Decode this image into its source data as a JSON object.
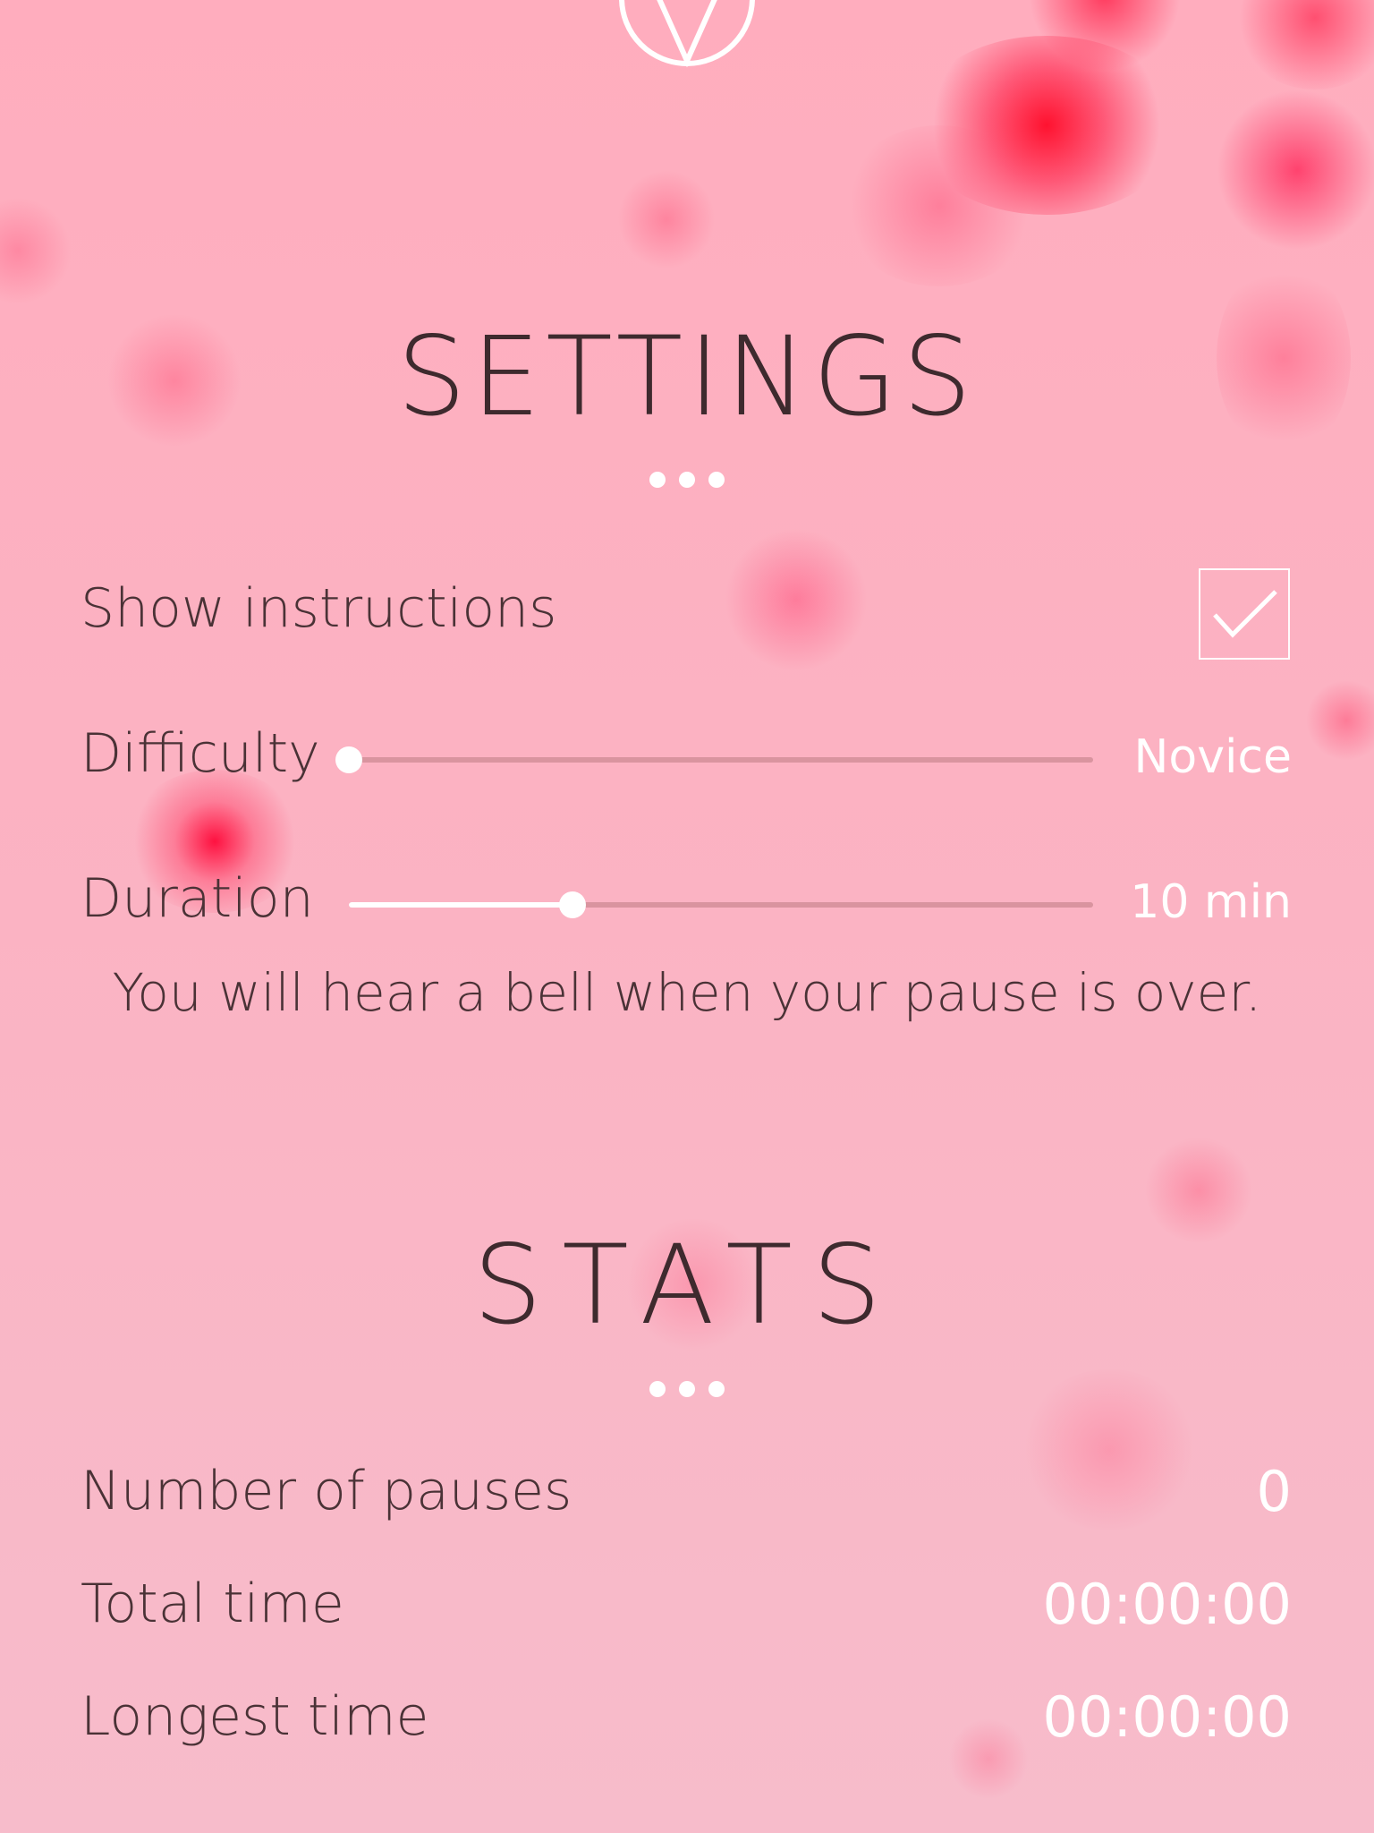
{
  "theme": {
    "background": "#fbb3c3",
    "text": "#4a3236",
    "title": "#3e2a2e",
    "value": "#ffffff",
    "slider_track": "#d9949f",
    "slider_fill": "#ffffff",
    "accent_blob": "#ff1744"
  },
  "header": {
    "logo_icon": "leaf-circle-icon"
  },
  "settings": {
    "title": "SETTINGS",
    "show_instructions": {
      "label": "Show instructions",
      "checked": true,
      "icon": "checkmark-icon"
    },
    "difficulty": {
      "label": "Difficulty",
      "value": "Novice",
      "level": 0.0
    },
    "duration": {
      "label": "Duration",
      "value": "10 min",
      "level": 0.3
    },
    "note": "You will hear a bell when your pause is over."
  },
  "stats": {
    "title": "STATS",
    "rows": [
      {
        "label": "Number of pauses",
        "value": "0"
      },
      {
        "label": "Total time",
        "value": "00:00:00"
      },
      {
        "label": "Longest time",
        "value": "00:00:00"
      }
    ]
  }
}
